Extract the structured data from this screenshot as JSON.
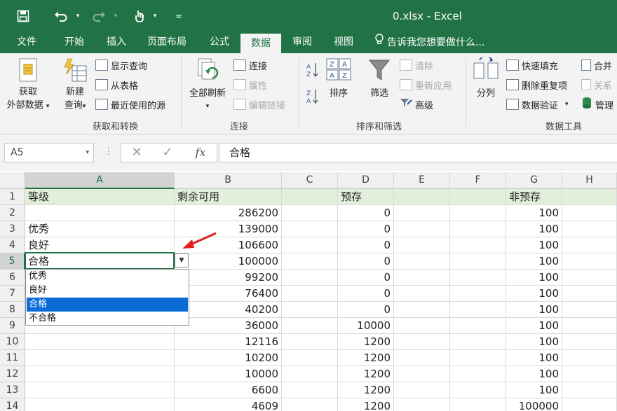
{
  "window": {
    "title": "0.xlsx - Excel"
  },
  "tabs": [
    "文件",
    "开始",
    "插入",
    "页面布局",
    "公式",
    "数据",
    "审阅",
    "视图"
  ],
  "active_tab": "数据",
  "tell_me": "告诉我您想要做什么...",
  "ribbon": {
    "get_transform": {
      "get_external_data": [
        "获取",
        "外部数据"
      ],
      "new_query": [
        "新建",
        "查询"
      ],
      "show_queries": "显示查询",
      "from_table": "从表格",
      "recent_sources": "最近使用的源",
      "label": "获取和转换"
    },
    "connections": {
      "refresh_all": "全部刷新",
      "connections": "连接",
      "properties": "属性",
      "edit_links": "编辑链接",
      "label": "连接"
    },
    "sort_filter": {
      "sort": "排序",
      "filter": "筛选",
      "clear": "清除",
      "reapply": "重新应用",
      "advanced": "高级",
      "label": "排序和筛选"
    },
    "data_tools": {
      "text_to_columns": "分列",
      "flash_fill": "快速填充",
      "remove_duplicates": "删除重复项",
      "data_validation": "数据验证",
      "merge": "合并",
      "relationships": "关系",
      "manage": "管理",
      "label": "数据工具"
    }
  },
  "formula_bar": {
    "name_box": "A5",
    "formula": "合格",
    "fx": "fx"
  },
  "grid": {
    "columns": [
      "A",
      "B",
      "C",
      "D",
      "E",
      "F",
      "G",
      "H"
    ],
    "selected_column": "A",
    "selected_row": "5",
    "rows": [
      {
        "n": "1",
        "A": "等级",
        "B": "剩余可用",
        "D": "预存",
        "G": "非预存"
      },
      {
        "n": "2",
        "A": "",
        "B": "286200",
        "D": "0",
        "G": "100"
      },
      {
        "n": "3",
        "A": "优秀",
        "B": "139000",
        "D": "0",
        "G": "100"
      },
      {
        "n": "4",
        "A": "良好",
        "B": "106600",
        "D": "0",
        "G": "100"
      },
      {
        "n": "5",
        "A": "合格",
        "B": "100000",
        "D": "0",
        "G": "100"
      },
      {
        "n": "6",
        "A": "",
        "B": "99200",
        "D": "0",
        "G": "100"
      },
      {
        "n": "7",
        "A": "",
        "B": "76400",
        "D": "0",
        "G": "100"
      },
      {
        "n": "8",
        "A": "",
        "B": "40200",
        "D": "0",
        "G": "100"
      },
      {
        "n": "9",
        "A": "",
        "B": "36000",
        "D": "10000",
        "G": "100"
      },
      {
        "n": "10",
        "A": "",
        "B": "12116",
        "D": "1200",
        "G": "100"
      },
      {
        "n": "11",
        "A": "",
        "B": "10200",
        "D": "1200",
        "G": "100"
      },
      {
        "n": "12",
        "A": "",
        "B": "10000",
        "D": "1200",
        "G": "100"
      },
      {
        "n": "13",
        "A": "",
        "B": "6600",
        "D": "1200",
        "G": "100"
      },
      {
        "n": "14",
        "A": "",
        "B": "4609",
        "D": "1200",
        "G": "100000"
      }
    ]
  },
  "dropdown": {
    "options": [
      "优秀",
      "良好",
      "合格",
      "不合格"
    ],
    "selected": "合格"
  },
  "colors": {
    "brand": "#217346",
    "header_fill": "#e2efda",
    "selection": "#0a6bd6",
    "arrow": "#e02020"
  }
}
